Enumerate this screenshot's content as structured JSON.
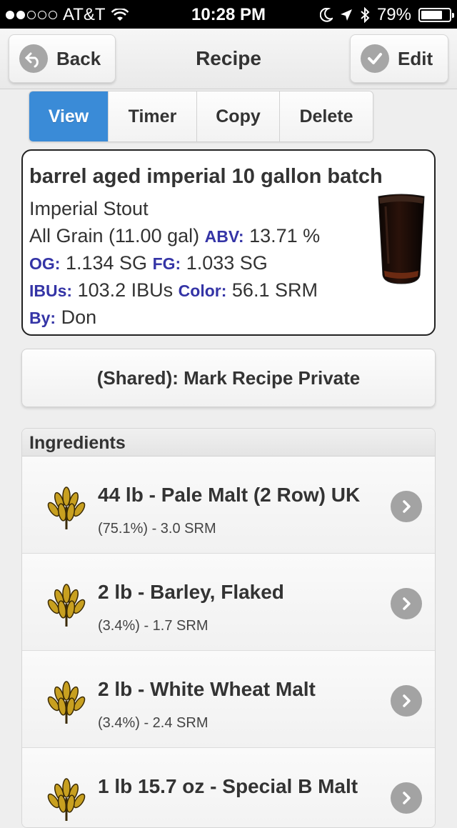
{
  "status": {
    "carrier": "AT&T",
    "time": "10:28 PM",
    "battery": "79%",
    "battery_level": 0.79
  },
  "header": {
    "back_label": "Back",
    "title": "Recipe",
    "edit_label": "Edit"
  },
  "tabs": [
    {
      "label": "View",
      "active": true
    },
    {
      "label": "Timer",
      "active": false
    },
    {
      "label": "Copy",
      "active": false
    },
    {
      "label": "Delete",
      "active": false
    }
  ],
  "recipe": {
    "name": "barrel aged imperial 10 gallon batch",
    "style": "Imperial Stout",
    "type_size": "All Grain (11.00 gal)",
    "abv_label": "ABV:",
    "abv": "13.71 %",
    "og_label": "OG:",
    "og": "1.134 SG",
    "fg_label": "FG:",
    "fg": "1.033 SG",
    "ibu_label": "IBUs:",
    "ibu": "103.2 IBUs",
    "color_label": "Color:",
    "color": "56.1 SRM",
    "by_label": "By:",
    "by": "Don"
  },
  "share_button": "(Shared): Mark Recipe Private",
  "ingredients": {
    "heading": "Ingredients",
    "items": [
      {
        "name": "44 lb - Pale Malt (2 Row) UK",
        "detail": "(75.1%) - 3.0 SRM"
      },
      {
        "name": "2 lb - Barley, Flaked",
        "detail": "(3.4%) - 1.7 SRM"
      },
      {
        "name": "2 lb - White Wheat Malt",
        "detail": "(3.4%) - 2.4 SRM"
      },
      {
        "name": "1 lb 15.7 oz - Special B Malt",
        "detail": ""
      }
    ]
  },
  "colors": {
    "accent": "#3a8bd7",
    "label": "#3434a6"
  }
}
